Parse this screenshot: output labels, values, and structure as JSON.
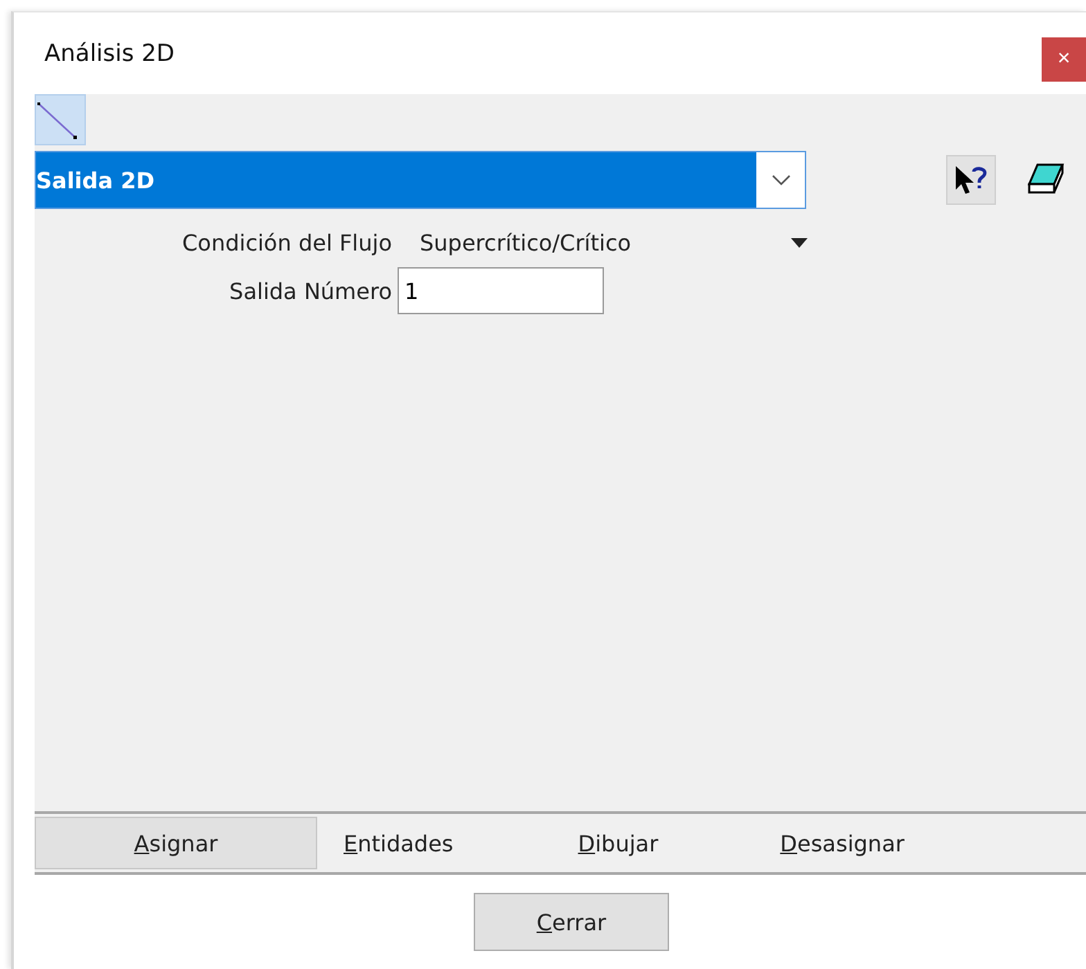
{
  "window": {
    "title": "Análisis 2D",
    "close": "×"
  },
  "entity_type": {
    "value": "Salida 2D"
  },
  "fields": [
    {
      "kind": "dropdown",
      "label": "Condición del Flujo",
      "value": "Supercrítico/Crítico"
    },
    {
      "kind": "input",
      "label": "Salida Número",
      "value": "1"
    }
  ],
  "action_tabs": [
    {
      "key": "A",
      "rest": "signar",
      "selected": true
    },
    {
      "key": "E",
      "rest": "ntidades",
      "selected": false
    },
    {
      "key": "D",
      "rest": "ibujar",
      "selected": false
    },
    {
      "key": "D",
      "rest": "esasignar",
      "selected": false
    }
  ],
  "close_button": {
    "key": "C",
    "rest": "errar"
  }
}
